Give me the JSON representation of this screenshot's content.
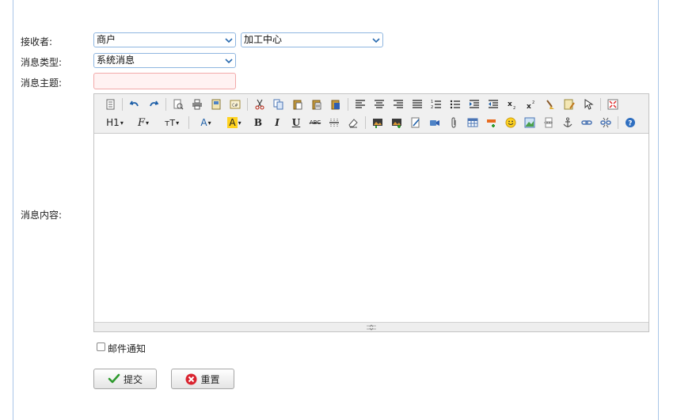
{
  "form": {
    "recipient_label": "接收者:",
    "recipient_type_value": "商户",
    "recipient_target_value": "加工中心",
    "message_type_label": "消息类型:",
    "message_type_value": "系统消息",
    "subject_label": "消息主题:",
    "subject_value": "",
    "content_label": "消息内容:",
    "email_notify_label": "邮件通知",
    "email_notify_checked": false,
    "submit_label": "提交",
    "reset_label": "重置"
  },
  "editor": {
    "toolbar_row2_text": {
      "heading": "H1",
      "font_family": "F",
      "font_size": "тT",
      "font_color": "A",
      "bg_color": "A",
      "bold": "B",
      "italic": "I",
      "underline": "U",
      "strikethrough": "ABC"
    }
  },
  "colors": {
    "frame_border": "#a9c6e8",
    "select_border": "#8fb6e0",
    "subject_border": "#f2a9a9",
    "subject_bg": "#fff2f2",
    "submit_icon": "#2e9a2e",
    "reset_icon": "#d9232f"
  }
}
